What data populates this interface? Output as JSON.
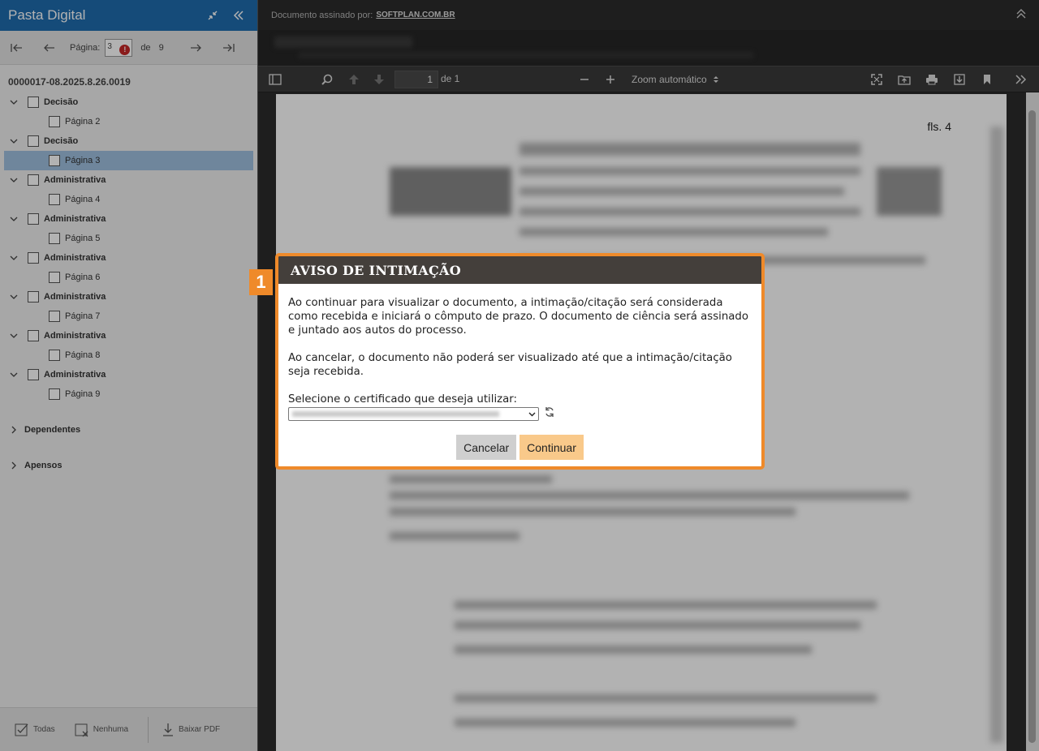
{
  "sidebar": {
    "title": "Pasta Digital",
    "pager": {
      "label": "Página:",
      "current": "3",
      "of": "de",
      "total": "9"
    },
    "process_number": "0000017-08.2025.8.26.0019",
    "tree": [
      {
        "type": "doc",
        "label": "Decisão"
      },
      {
        "type": "page",
        "label": "Página 2"
      },
      {
        "type": "doc",
        "label": "Decisão"
      },
      {
        "type": "page",
        "label": "Página 3",
        "selected": true
      },
      {
        "type": "doc",
        "label": "Administrativa"
      },
      {
        "type": "page",
        "label": "Página 4"
      },
      {
        "type": "doc",
        "label": "Administrativa"
      },
      {
        "type": "page",
        "label": "Página 5"
      },
      {
        "type": "doc",
        "label": "Administrativa"
      },
      {
        "type": "page",
        "label": "Página 6"
      },
      {
        "type": "doc",
        "label": "Administrativa"
      },
      {
        "type": "page",
        "label": "Página 7"
      },
      {
        "type": "doc",
        "label": "Administrativa"
      },
      {
        "type": "page",
        "label": "Página 8"
      },
      {
        "type": "doc",
        "label": "Administrativa"
      },
      {
        "type": "page",
        "label": "Página 9"
      }
    ],
    "groups": {
      "dependentes": "Dependentes",
      "apensos": "Apensos"
    },
    "footer": {
      "all": "Todas",
      "none": "Nenhuma",
      "download": "Baixar PDF"
    }
  },
  "viewer": {
    "signed_by_label": "Documento assinado por:",
    "signed_by_brand": "SOFTPLAN.COM.BR",
    "toolbar": {
      "page": "1",
      "of": "de 1",
      "zoom": "Zoom automático"
    },
    "page_label": "fls. 4"
  },
  "modal": {
    "badge": "1",
    "title": "AVISO DE INTIMAÇÃO",
    "paragraph1": "Ao continuar para visualizar o documento, a intimação/citação será considerada como recebida e iniciará o cômputo de prazo. O documento de ciência será assinado e juntado aos autos do processo.",
    "paragraph2": "Ao cancelar, o documento não poderá ser visualizado até que a intimação/citação seja recebida.",
    "select_label": "Selecione o certificado que deseja utilizar:",
    "cancel": "Cancelar",
    "continue": "Continuar"
  },
  "colors": {
    "sidebar_header": "#1f6cae",
    "modal_border": "#ef8a2a",
    "modal_header": "#443f3b",
    "continue_button": "#f9c98a"
  }
}
